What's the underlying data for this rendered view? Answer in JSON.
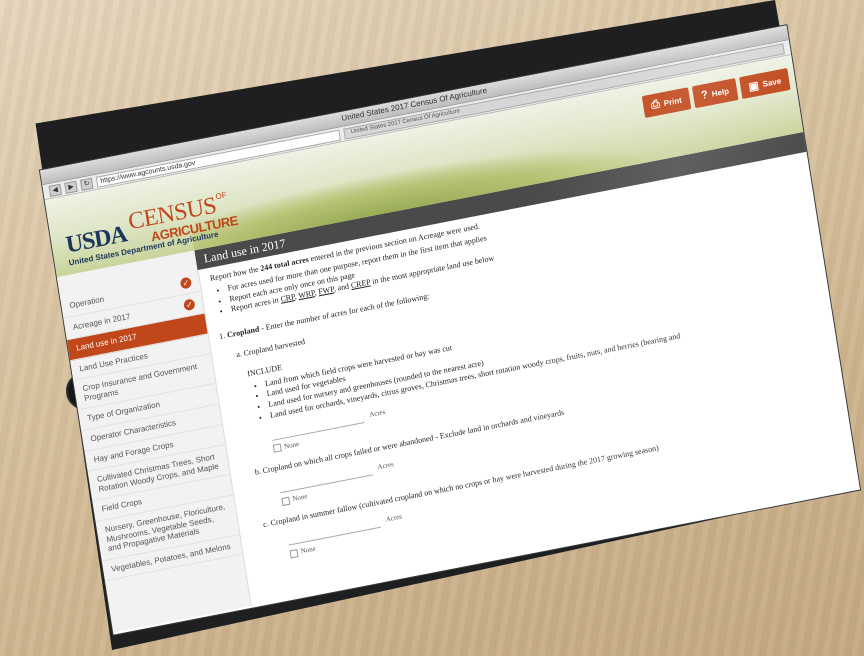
{
  "browser": {
    "window_title": "United States 2017 Census Of Agriculture",
    "url": "https://www.agcounts.usda.gov",
    "tab_title": "United States 2017 Census Of Agriculture"
  },
  "header": {
    "logo_usda": "USDA",
    "logo_census": "CENSUS",
    "logo_of": "OF",
    "logo_agriculture": "AGRICULTURE",
    "department": "United States Department of Agriculture",
    "buttons": {
      "print": "Print",
      "help": "Help",
      "save": "Save"
    }
  },
  "sidebar": {
    "items": [
      {
        "label": "Operation",
        "checked": true,
        "active": false
      },
      {
        "label": "Acreage in 2017",
        "checked": true,
        "active": false
      },
      {
        "label": "Land use in 2017",
        "checked": false,
        "active": true
      },
      {
        "label": "Land Use Practices",
        "checked": false,
        "active": false
      },
      {
        "label": "Crop Insurance and Government Programs",
        "checked": false,
        "active": false
      },
      {
        "label": "Type of Organization",
        "checked": false,
        "active": false
      },
      {
        "label": "Operator Characteristics",
        "checked": false,
        "active": false
      },
      {
        "label": "Hay and Forage Crops",
        "checked": false,
        "active": false
      },
      {
        "label": "Cultivated Christmas Trees, Short Rotation Woody Crops, and Maple",
        "checked": false,
        "active": false
      },
      {
        "label": "Field Crops",
        "checked": false,
        "active": false
      },
      {
        "label": "Nursery, Greenhouse, Floriculture, Mushrooms, Vegetable Seeds, and Propagative Materials",
        "checked": false,
        "active": false
      },
      {
        "label": "Vegetables, Potatoes, and Melons",
        "checked": false,
        "active": false
      }
    ]
  },
  "main": {
    "section_title": "Land use in 2017",
    "intro_before": "Report how the ",
    "intro_bold": "244 total acres",
    "intro_after": " entered in the previous section on Acreage were used.",
    "bullets": [
      "For acres used for more than one purpose, report them in the first item that applies",
      "Report each acre only once on this page"
    ],
    "bullet3_before": "Report acres in ",
    "bullet3_links": [
      "CRP",
      "WRP",
      "FWP",
      "CREP"
    ],
    "bullet3_after": " in the most appropriate land use below",
    "q1_number": "1.",
    "q1_bold": "Cropland",
    "q1_text": " - Enter the number of acres for each of the following:",
    "qa_label": "a. Cropland harvested",
    "include_label": "INCLUDE",
    "include_items": [
      "Land from which field crops were harvested or hay was cut",
      "Land used for vegetables",
      "Land used for nursery and greenhouses (rounded to the nearest acre)",
      "Land used for orchards, vineyards, citrus groves, Christmas trees, short rotation woody crops, fruits, nuts, and berries (bearing and"
    ],
    "acres_label": "Acres",
    "none_label": "None",
    "qb_label": "b. Cropland on which all crops failed or were abandoned - Exclude land in orchards and vineyards",
    "qc_label": "c. Cropland in summer fallow (cultivated cropland on which no crops or hay were harvested during the 2017 growing season)"
  }
}
